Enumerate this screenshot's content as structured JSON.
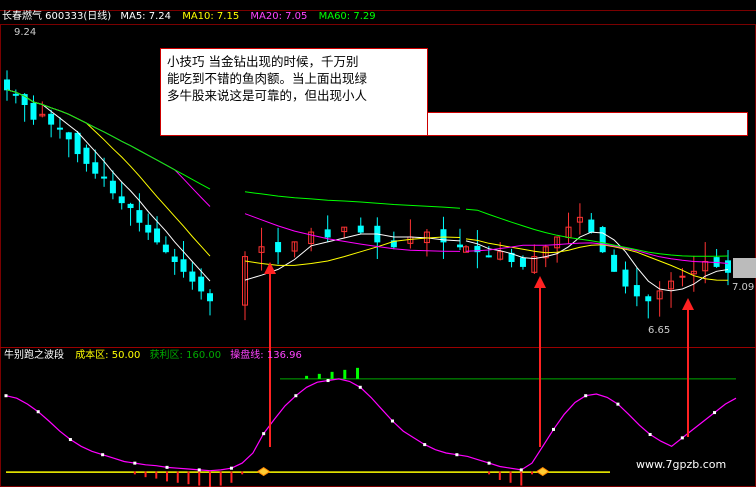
{
  "header": {
    "stock": "长春燃气 600333(日线)",
    "ma5_label": "MA5: 7.24",
    "ma10_label": "MA10: 7.15",
    "ma20_label": "MA20: 7.05",
    "ma60_label": "MA60: 7.29",
    "colors": {
      "ma5": "#ffffff",
      "ma10": "#ffff00",
      "ma20": "#ff00ff",
      "ma60": "#00ff00"
    }
  },
  "note": {
    "line1": "小技巧  当金钻出现的时候，千万别",
    "line2": "能吃到不错的鱼肉额。当上面出现绿",
    "line3": "多牛股来说这是可靠的，但出现小人"
  },
  "price_marks": {
    "high": "9.24",
    "low": "6.65",
    "last": "7.09"
  },
  "indicator": {
    "name": "牛别跑之波段",
    "cost_zone_label": "成本区: 50.00",
    "profit_zone_label": "获利区: 160.00",
    "trade_line_label": "操盘线: 136.96"
  },
  "watermark": "www.7gpzb.com",
  "chart_data": [
    {
      "type": "candlestick",
      "title": "长春燃气 600333(日线)",
      "series": [
        {
          "name": "MA5",
          "value": 7.24
        },
        {
          "name": "MA10",
          "value": 7.15
        },
        {
          "name": "MA20",
          "value": 7.05
        },
        {
          "name": "MA60",
          "value": 7.29
        }
      ],
      "annotations": [
        "9.24",
        "6.65",
        "7.09"
      ],
      "close": [
        8.95,
        8.9,
        8.8,
        8.65,
        8.7,
        8.6,
        8.55,
        8.45,
        8.3,
        8.2,
        8.1,
        8.05,
        7.9,
        7.8,
        7.75,
        7.6,
        7.5,
        7.4,
        7.3,
        7.2,
        7.1,
        7.0,
        6.9,
        6.8,
        7.25,
        7.35,
        7.3,
        7.4,
        7.5,
        7.45,
        7.55,
        7.5,
        7.4,
        7.35,
        7.45,
        7.5,
        7.4,
        7.35,
        7.35,
        7.3,
        7.25,
        7.3,
        7.2,
        7.15,
        7.25,
        7.35,
        7.45,
        7.55,
        7.65,
        7.5,
        7.3,
        7.1,
        6.95,
        6.85,
        6.8,
        6.9,
        7.0,
        7.05,
        7.1,
        7.2,
        7.15,
        7.09
      ]
    },
    {
      "type": "line",
      "title": "牛别跑之波段",
      "series": [
        {
          "name": "成本区",
          "value": 50.0
        },
        {
          "name": "获利区",
          "value": 160.0
        },
        {
          "name": "操盘线",
          "value": 136.96
        }
      ],
      "y": [
        140,
        137,
        130,
        121,
        110,
        98,
        88,
        80,
        74,
        70,
        66,
        62,
        60,
        58,
        57,
        55,
        54,
        53,
        52,
        51,
        52,
        54,
        60,
        72,
        95,
        112,
        128,
        140,
        150,
        156,
        158,
        160,
        157,
        150,
        138,
        124,
        110,
        98,
        90,
        82,
        76,
        72,
        70,
        68,
        64,
        60,
        56,
        54,
        52,
        60,
        80,
        100,
        118,
        132,
        140,
        142,
        138,
        130,
        118,
        105,
        94,
        86,
        80,
        90,
        100,
        110,
        120,
        130,
        137
      ],
      "ylim": [
        40,
        180
      ]
    }
  ]
}
